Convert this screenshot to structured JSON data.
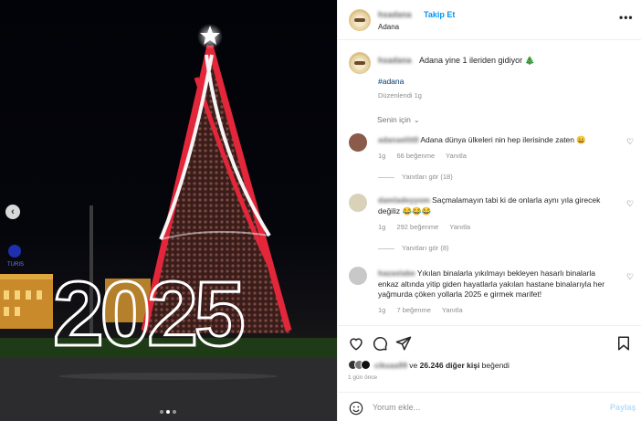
{
  "post": {
    "username_blurred": "hsadana",
    "follow_label": "Takip Et",
    "location": "Adana",
    "more_label": "•••",
    "caption": {
      "username_blurred": "hsadana",
      "text": "Adana yine 1 ileriden gidiyor 🎄",
      "hashtag": "#adana",
      "edited": "Düzenlendi  1g"
    },
    "for_you_label": "Senin için",
    "photo": {
      "year_text": "2025",
      "carousel_dots": 3,
      "active_dot": 1,
      "prev_label": "‹"
    }
  },
  "comments": [
    {
      "username_blurred": "adanaelitt0",
      "text": "Adana dünya ülkeleri nin hep ilerisinde zaten 😄",
      "time": "1g",
      "likes": "66 beğenme",
      "reply": "Yanıtla",
      "view_replies": "Yanıtları gör (18)",
      "avatar_color": "#8a5a4a"
    },
    {
      "username_blurred": "damladeyyom",
      "text": "Saçmalamayın tabi ki de onlarla aynı yıla girecek değiliz 😂😂😂",
      "time": "1g",
      "likes": "292 beğenme",
      "reply": "Yanıtla",
      "view_replies": "Yanıtları gör (8)",
      "avatar_color": "#d9d2b8"
    },
    {
      "username_blurred": "hazaslabe",
      "text": "Yıkılan binalarla yıkılmayı bekleyen hasarlı binalarla enkaz altında yitip giden hayatlarla yakılan hastane binalarıyla her yağmurda çöken yollarla 2025 e girmek marifet!",
      "time": "1g",
      "likes": "7 beğenme",
      "reply": "Yanıtla",
      "avatar_color": "#c8c8c8"
    }
  ],
  "actions": {
    "like_icon": "heart-outline-icon",
    "comment_icon": "comment-bubble-icon",
    "share_icon": "paper-plane-icon",
    "save_icon": "bookmark-icon"
  },
  "likes": {
    "blurred_name": "cikuaa99",
    "text_suffix": " ve ",
    "count": "26.246 diğer kişi",
    "liked_label": " beğendi",
    "time_ago": "1 gün önce"
  },
  "comment_box": {
    "placeholder": "Yorum ekle...",
    "share_label": "Paylaş"
  },
  "colors": {
    "link_blue": "#0095f6",
    "hashtag_blue": "#00376b",
    "muted_gray": "#8e8e8e",
    "tree_red": "#e3263a"
  }
}
